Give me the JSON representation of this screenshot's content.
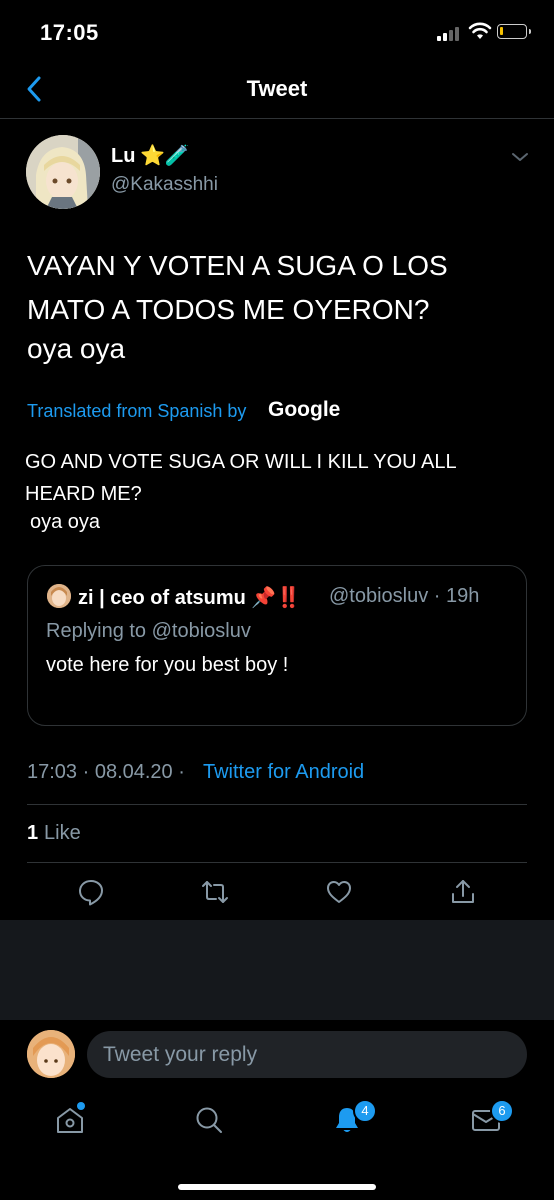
{
  "status_bar": {
    "time": "17:05"
  },
  "nav": {
    "title": "Tweet"
  },
  "author": {
    "name": "Lu",
    "name_emoji": "⭐🧪",
    "handle": "@Kakasshhi"
  },
  "tweet": {
    "text_line1": "VAYAN Y VOTEN A SUGA O LOS",
    "text_line2": "MATO A TODOS ME OYERON?",
    "text_line3": "oya oya",
    "translated_label": "Translated from Spanish by",
    "translator": "Google",
    "translation_line1": "GO AND VOTE SUGA OR WILL I KILL YOU ALL",
    "translation_line2": "HEARD ME?",
    "translation_line3": "oya oya",
    "timestamp": "17:03 · 08.04.20 ·",
    "source": "Twitter for Android",
    "likes_count": "1",
    "likes_label": "Like"
  },
  "quote": {
    "name": "zi | ceo of atsumu 📌‼️",
    "handle_time": "@tobiosluv · 19h",
    "replying": "Replying to @tobiosluv",
    "text": "vote here for you best boy !"
  },
  "reply": {
    "placeholder": "Tweet your reply"
  },
  "tabs": {
    "notifications_badge": "4",
    "messages_badge": "6"
  },
  "colors": {
    "accent": "#1d9bf0",
    "secondary_text": "#8899a6",
    "background": "#000000"
  }
}
